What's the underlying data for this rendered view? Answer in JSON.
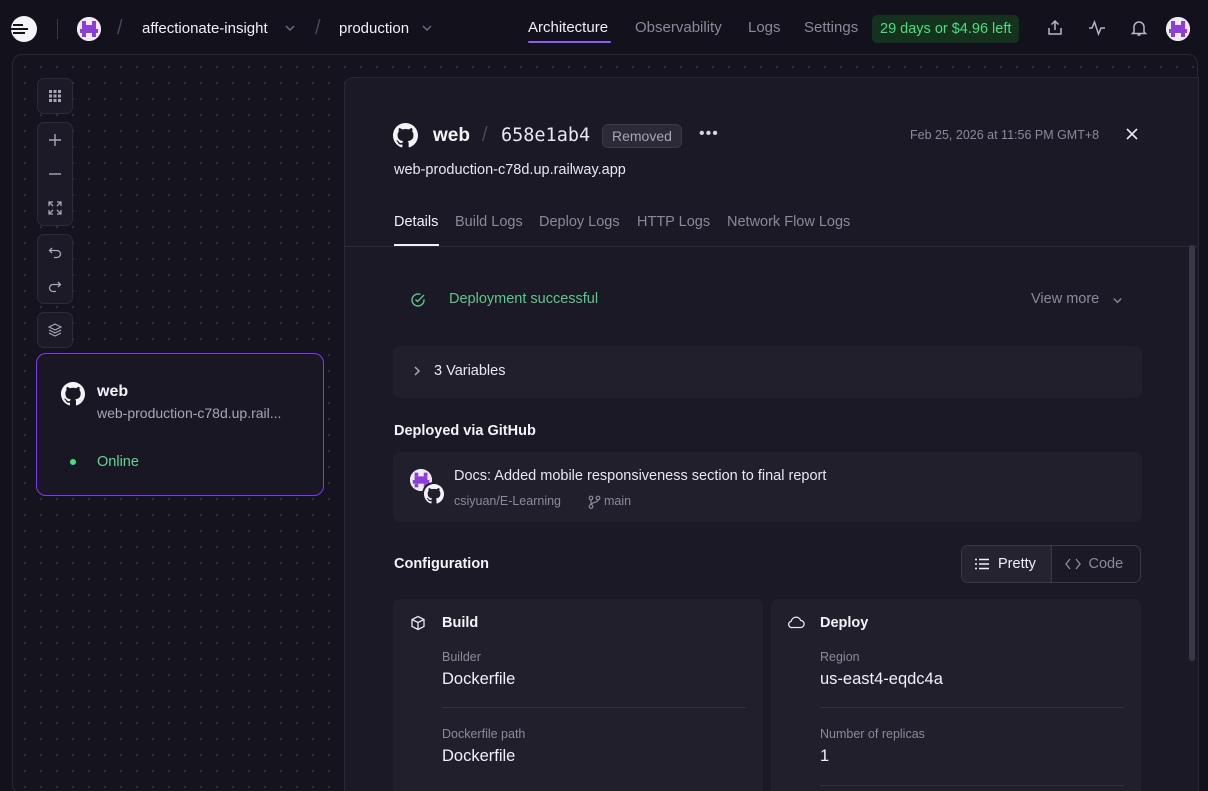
{
  "topbar": {
    "project_name": "affectionate-insight",
    "environment": "production",
    "nav": [
      "Architecture",
      "Observability",
      "Logs",
      "Settings"
    ],
    "active_nav": "Architecture",
    "trial_text": "29 days or $4.96 left",
    "icons": [
      "railway-logo-icon",
      "share-icon",
      "activity-icon",
      "bell-icon",
      "user-avatar-icon"
    ]
  },
  "canvas": {
    "toolbar_icons": [
      "grid-icon",
      "zoom-in-icon",
      "zoom-out-icon",
      "fit-view-icon",
      "undo-icon",
      "redo-icon",
      "layers-icon"
    ],
    "service_card": {
      "name": "web",
      "domain": "web-production-c78d.up.rail...",
      "status": "Online"
    }
  },
  "panel": {
    "service_name": "web",
    "deployment_hash": "658e1ab4",
    "badge": "Removed",
    "timestamp": "Feb 25, 2026 at 11:56 PM GMT+8",
    "url": "web-production-c78d.up.railway.app",
    "tabs": [
      "Details",
      "Build Logs",
      "Deploy Logs",
      "HTTP Logs",
      "Network Flow Logs"
    ],
    "active_tab": "Details",
    "deployment_status": "Deployment successful",
    "view_more": "View more",
    "variables_label": "3 Variables",
    "deployed_via_heading": "Deployed via GitHub",
    "commit": {
      "message": "Docs: Added mobile responsiveness section to final report",
      "repo": "csiyuan/E-Learning",
      "branch": "main"
    },
    "configuration_heading": "Configuration",
    "view_toggle": {
      "pretty": "Pretty",
      "code": "Code",
      "selected": "Pretty"
    },
    "build": {
      "title": "Build",
      "builder_label": "Builder",
      "builder_value": "Dockerfile",
      "dockerfile_path_label": "Dockerfile path",
      "dockerfile_path_value": "Dockerfile"
    },
    "deploy": {
      "title": "Deploy",
      "region_label": "Region",
      "region_value": "us-east4-eqdc4a",
      "replicas_label": "Number of replicas",
      "replicas_value": "1"
    }
  },
  "colors": {
    "accent": "#8b5cf6",
    "success": "#4ade80",
    "background": "#13111c",
    "panel": "#1b1925"
  }
}
